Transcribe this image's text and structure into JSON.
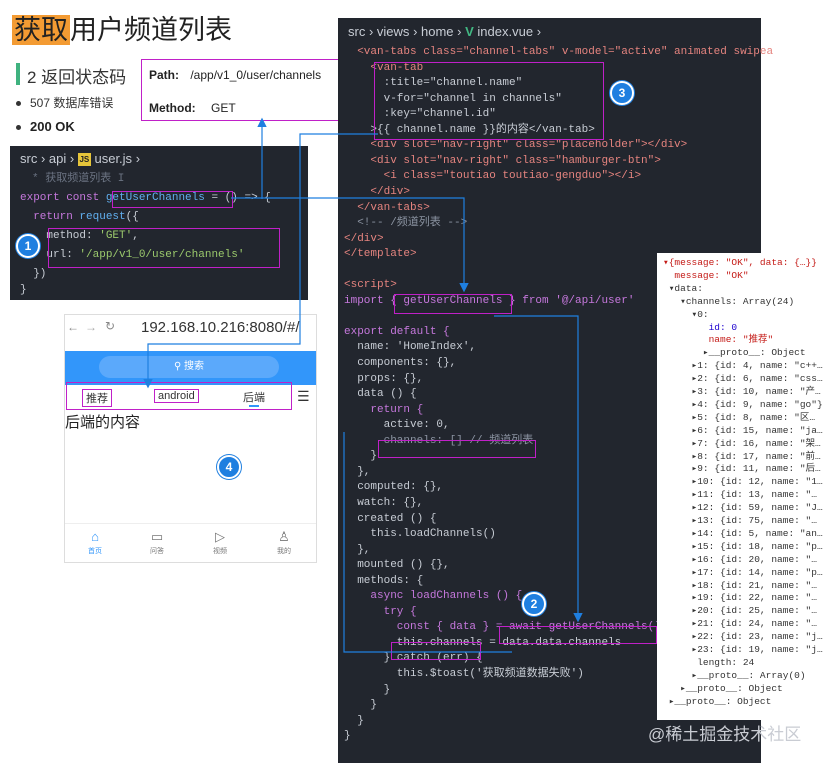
{
  "title": {
    "highlight": "获取",
    "rest": "用户频道列表"
  },
  "status": {
    "heading": "2 返回状态码",
    "items": [
      "507 数据库错误",
      "200 OK"
    ]
  },
  "api": {
    "path_label": "Path:",
    "path_value": "/app/v1_0/user/channels",
    "method_label": "Method:",
    "method_value": "GET"
  },
  "user_js": {
    "breadcrumb": [
      "src",
      "api",
      "user.js"
    ],
    "js_icon": "JS",
    "lines": [
      "* 获取频道列表 I",
      "export const getUserChannels = () => {",
      "  return request({",
      "    method: 'GET',",
      "    url: '/app/v1_0/user/channels'",
      "  })",
      "}"
    ]
  },
  "vue_file": {
    "breadcrumb": [
      "src",
      "views",
      "home",
      "index.vue"
    ],
    "lines": [
      "  <van-tabs class=\"channel-tabs\" v-model=\"active\" animated swipea",
      "    <van-tab",
      "      :title=\"channel.name\"",
      "      v-for=\"channel in channels\"",
      "      :key=\"channel.id\"",
      "    >{{ channel.name }}的内容</van-tab>",
      "    <div slot=\"nav-right\" class=\"placeholder\"></div>",
      "    <div slot=\"nav-right\" class=\"hamburger-btn\">",
      "      <i class=\"toutiao toutiao-gengduo\"></i>",
      "    </div>",
      "  </van-tabs>",
      "  <!-- /频道列表 -->",
      "</div>",
      "</template>",
      "",
      "<script>",
      "import { getUserChannels } from '@/api/user'",
      "",
      "export default {",
      "  name: 'HomeIndex',",
      "  components: {},",
      "  props: {},",
      "  data () {",
      "    return {",
      "      active: 0,",
      "      channels: [] // 频道列表",
      "    }",
      "  },",
      "  computed: {},",
      "  watch: {},",
      "  created () {",
      "    this.loadChannels()",
      "  },",
      "  mounted () {},",
      "  methods: {",
      "    async loadChannels () {",
      "      try {",
      "        const { data } = await getUserChannels()",
      "        this.channels = data.data.channels",
      "      } catch (err) {",
      "        this.$toast('获取频道数据失败')",
      "      }",
      "    }",
      "  }",
      "}"
    ]
  },
  "console": {
    "lines": [
      "▾{message: \"OK\", data: {…}}",
      "  message: \"OK\"",
      " ▾data:",
      "   ▾channels: Array(24)",
      "     ▾0:",
      "        id: 0",
      "        name: \"推荐\"",
      "       ▸__proto__: Object",
      "     ▸1: {id: 4, name: \"c++…",
      "     ▸2: {id: 6, name: \"css…",
      "     ▸3: {id: 10, name: \"产…",
      "     ▸4: {id: 9, name: \"go\"}",
      "     ▸5: {id: 8, name: \"区…",
      "     ▸6: {id: 15, name: \"ja…",
      "     ▸7: {id: 16, name: \"架…",
      "     ▸8: {id: 17, name: \"前…",
      "     ▸9: {id: 11, name: \"后…",
      "     ▸10: {id: 12, name: \"1…",
      "     ▸11: {id: 13, name: \"…",
      "     ▸12: {id: 59, name: \"J…",
      "     ▸13: {id: 75, name: \"…",
      "     ▸14: {id: 5, name: \"an…",
      "     ▸15: {id: 18, name: \"p…",
      "     ▸16: {id: 20, name: \"…",
      "     ▸17: {id: 14, name: \"p…",
      "     ▸18: {id: 21, name: \"…",
      "     ▸19: {id: 22, name: \"…",
      "     ▸20: {id: 25, name: \"…",
      "     ▸21: {id: 24, name: \"…",
      "     ▸22: {id: 23, name: \"j…",
      "     ▸23: {id: 19, name: \"j…",
      "      length: 24",
      "     ▸__proto__: Array(0)",
      "   ▸__proto__: Object",
      " ▸__proto__: Object"
    ]
  },
  "phone": {
    "url": "192.168.10.216:8080/#/",
    "search_label": "搜索",
    "tabs": [
      "推荐",
      "android",
      "后端"
    ],
    "content": "后端的内容",
    "bottom_nav": [
      "首页",
      "问答",
      "视频",
      "我的"
    ]
  },
  "badges": [
    "1",
    "2",
    "3",
    "4"
  ],
  "watermark": "@稀土掘金技术社区",
  "colors": {
    "highlight": "#f39b33",
    "annotation": "#c020c8",
    "arrow": "#1f7fe0",
    "brand": "#3296fa"
  }
}
